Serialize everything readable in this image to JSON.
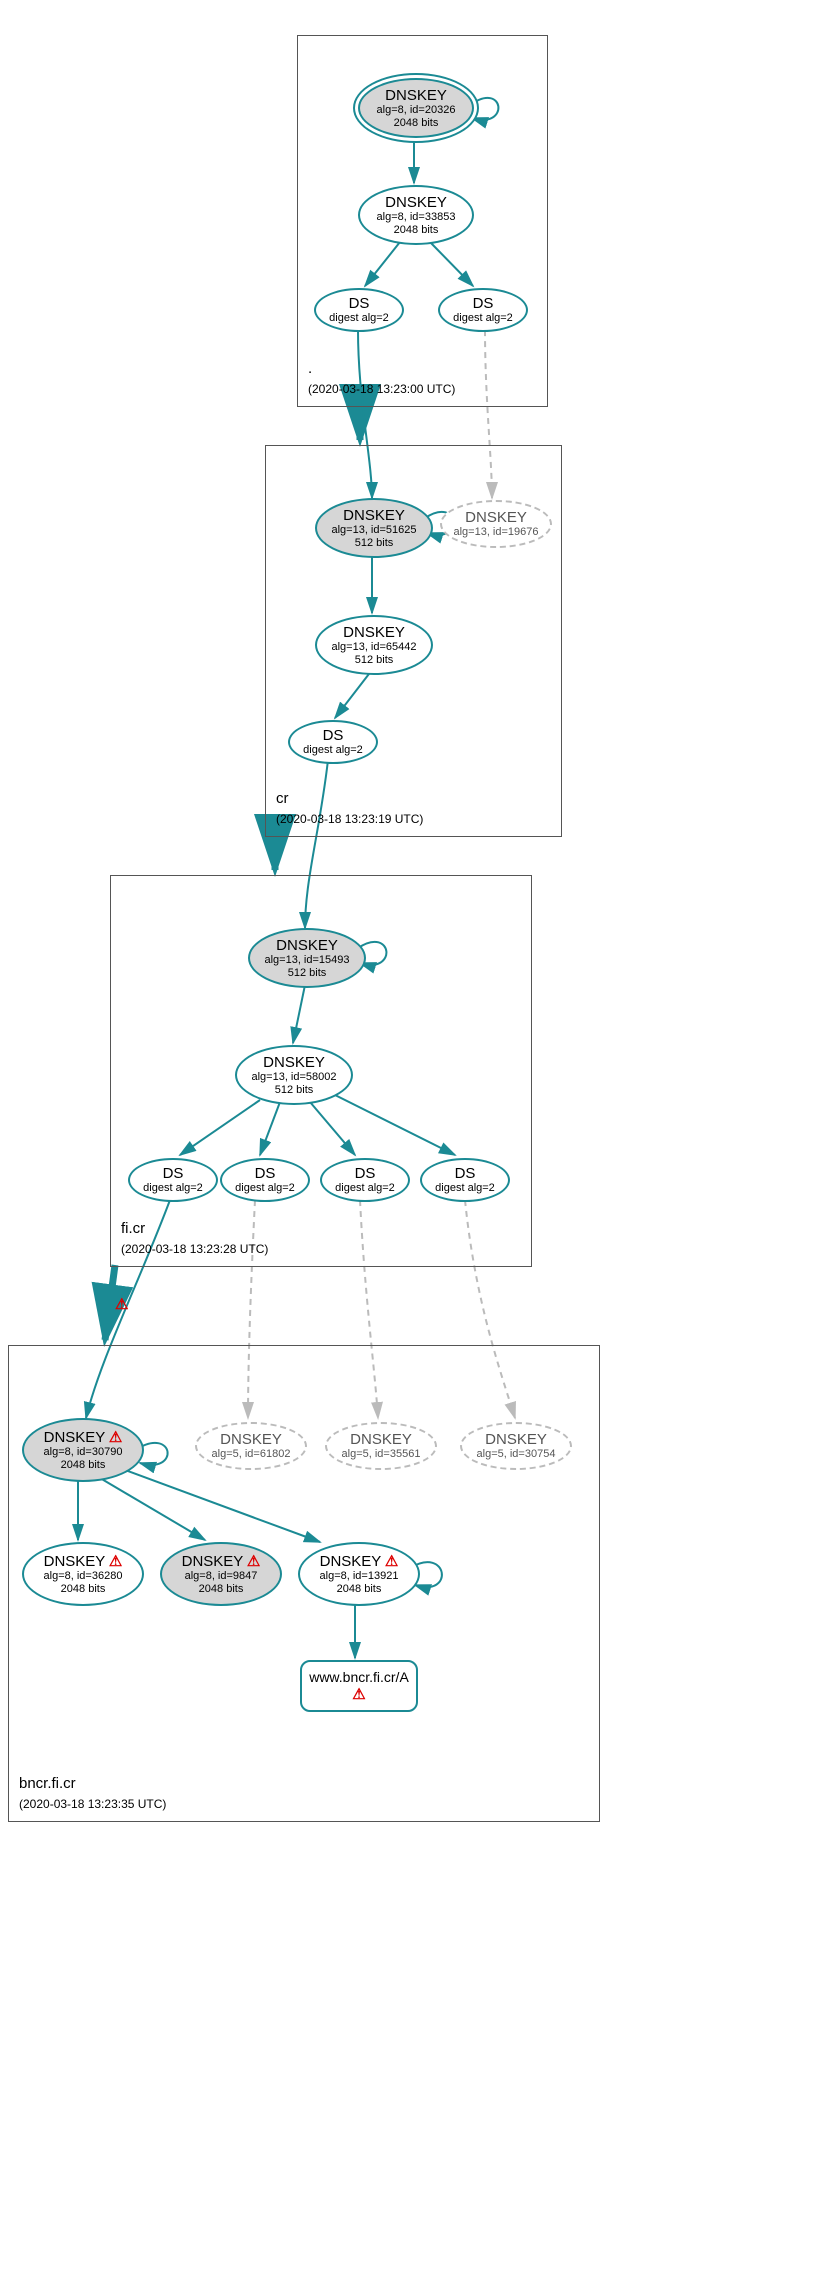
{
  "zones": {
    "root": {
      "name": ".",
      "timestamp": "(2020-03-18 13:23:00 UTC)"
    },
    "cr": {
      "name": "cr",
      "timestamp": "(2020-03-18 13:23:19 UTC)"
    },
    "ficr": {
      "name": "fi.cr",
      "timestamp": "(2020-03-18 13:23:28 UTC)"
    },
    "bncr": {
      "name": "bncr.fi.cr",
      "timestamp": "(2020-03-18 13:23:35 UTC)"
    }
  },
  "nodes": {
    "root_ksk": {
      "title": "DNSKEY",
      "sub1": "alg=8, id=20326",
      "sub2": "2048 bits"
    },
    "root_zsk": {
      "title": "DNSKEY",
      "sub1": "alg=8, id=33853",
      "sub2": "2048 bits"
    },
    "root_ds1": {
      "title": "DS",
      "sub1": "digest alg=2"
    },
    "root_ds2": {
      "title": "DS",
      "sub1": "digest alg=2"
    },
    "cr_ksk": {
      "title": "DNSKEY",
      "sub1": "alg=13, id=51625",
      "sub2": "512 bits"
    },
    "cr_extra": {
      "title": "DNSKEY",
      "sub1": "alg=13, id=19676"
    },
    "cr_zsk": {
      "title": "DNSKEY",
      "sub1": "alg=13, id=65442",
      "sub2": "512 bits"
    },
    "cr_ds": {
      "title": "DS",
      "sub1": "digest alg=2"
    },
    "ficr_ksk": {
      "title": "DNSKEY",
      "sub1": "alg=13, id=15493",
      "sub2": "512 bits"
    },
    "ficr_zsk": {
      "title": "DNSKEY",
      "sub1": "alg=13, id=58002",
      "sub2": "512 bits"
    },
    "ficr_ds1": {
      "title": "DS",
      "sub1": "digest alg=2"
    },
    "ficr_ds2": {
      "title": "DS",
      "sub1": "digest alg=2"
    },
    "ficr_ds3": {
      "title": "DS",
      "sub1": "digest alg=2"
    },
    "ficr_ds4": {
      "title": "DS",
      "sub1": "digest alg=2"
    },
    "bncr_ksk": {
      "title": "DNSKEY",
      "sub1": "alg=8, id=30790",
      "sub2": "2048 bits"
    },
    "bncr_d1": {
      "title": "DNSKEY",
      "sub1": "alg=5, id=61802"
    },
    "bncr_d2": {
      "title": "DNSKEY",
      "sub1": "alg=5, id=35561"
    },
    "bncr_d3": {
      "title": "DNSKEY",
      "sub1": "alg=5, id=30754"
    },
    "bncr_k1": {
      "title": "DNSKEY",
      "sub1": "alg=8, id=36280",
      "sub2": "2048 bits"
    },
    "bncr_k2": {
      "title": "DNSKEY",
      "sub1": "alg=8, id=9847",
      "sub2": "2048 bits"
    },
    "bncr_k3": {
      "title": "DNSKEY",
      "sub1": "alg=8, id=13921",
      "sub2": "2048 bits"
    },
    "bncr_rr": {
      "title": "www.bncr.fi.cr/A"
    }
  },
  "icons": {
    "warn": "⚠"
  }
}
